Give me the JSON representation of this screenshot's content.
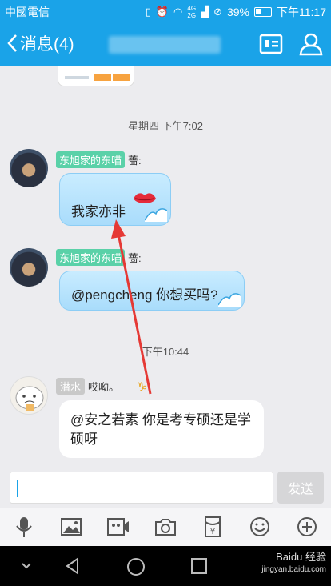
{
  "status_bar": {
    "carrier": "中國電信",
    "net_4g": "4G",
    "net_2g": "2G",
    "battery_percent": "39%",
    "time": "下午11:17"
  },
  "header": {
    "back_label": "消息(4)",
    "accent_color": "#1aa3e8"
  },
  "messages": [
    {
      "timestamp": "星期四 下午7:02"
    },
    {
      "sender_tag": "东旭家的东喵",
      "sender_name": "蔷:",
      "text": "我家亦非",
      "emoji": "lips-emoji"
    },
    {
      "sender_tag": "东旭家的东喵",
      "sender_name": "蔷:",
      "text": "@pengcheng 你想买吗?"
    },
    {
      "timestamp": "下午10:44"
    },
    {
      "sender_tag": "潜水",
      "sender_name": "哎呦。",
      "sign": "♑",
      "text": "@安之若素 你是考专硕还是学硕呀"
    }
  ],
  "input": {
    "value": "",
    "send_label": "发送"
  },
  "toolbar": [
    "mic-icon",
    "image-icon",
    "video-icon",
    "camera-icon",
    "red-packet-icon",
    "emoji-icon",
    "plus-icon"
  ],
  "watermark": {
    "line1": "Baidu 经验",
    "line2": "jingyan.baidu.com"
  }
}
